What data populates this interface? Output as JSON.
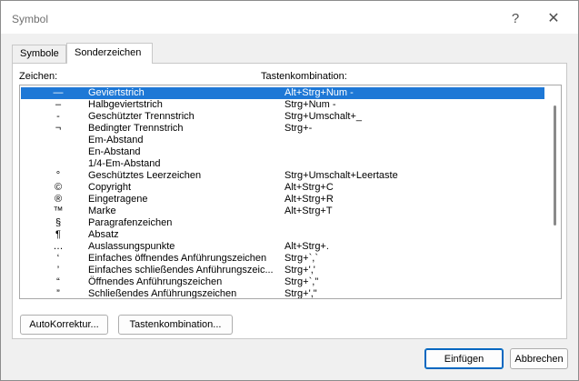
{
  "window": {
    "title": "Symbol",
    "help_glyph": "?",
    "close_glyph": "✕"
  },
  "tabs": [
    {
      "label": "Symbole"
    },
    {
      "label": "Sonderzeichen",
      "active": true
    }
  ],
  "columns": {
    "char_label": "Zeichen:",
    "shortcut_label": "Tastenkombination:"
  },
  "rows": [
    {
      "symbol": "—",
      "name": "Geviertstrich",
      "keys": "Alt+Strg+Num -",
      "selected": true
    },
    {
      "symbol": "–",
      "name": "Halbgeviertstrich",
      "keys": "Strg+Num -"
    },
    {
      "symbol": "-",
      "name": "Geschützter Trennstrich",
      "keys": "Strg+Umschalt+_"
    },
    {
      "symbol": "¬",
      "name": "Bedingter Trennstrich",
      "keys": "Strg+-"
    },
    {
      "symbol": "",
      "name": "Em-Abstand",
      "keys": ""
    },
    {
      "symbol": "",
      "name": "En-Abstand",
      "keys": ""
    },
    {
      "symbol": "",
      "name": "1/4-Em-Abstand",
      "keys": ""
    },
    {
      "symbol": "°",
      "name": "Geschütztes Leerzeichen",
      "keys": "Strg+Umschalt+Leertaste"
    },
    {
      "symbol": "©",
      "name": "Copyright",
      "keys": "Alt+Strg+C"
    },
    {
      "symbol": "®",
      "name": "Eingetragene",
      "keys": "Alt+Strg+R"
    },
    {
      "symbol": "™",
      "name": "Marke",
      "keys": "Alt+Strg+T"
    },
    {
      "symbol": "§",
      "name": "Paragrafenzeichen",
      "keys": ""
    },
    {
      "symbol": "¶",
      "name": "Absatz",
      "keys": ""
    },
    {
      "symbol": "…",
      "name": "Auslassungspunkte",
      "keys": "Alt+Strg+."
    },
    {
      "symbol": "‘",
      "name": "Einfaches öffnendes Anführungszeichen",
      "keys": "Strg+`,`"
    },
    {
      "symbol": "’",
      "name": "Einfaches schließendes Anführungszeic...",
      "keys": "Strg+','"
    },
    {
      "symbol": "“",
      "name": "Öffnendes Anführungszeichen",
      "keys": "Strg+`,\""
    },
    {
      "symbol": "”",
      "name": "Schließendes Anführungszeichen",
      "keys": "Strg+',\""
    }
  ],
  "buttons": {
    "autokorrektur": "AutoKorrektur...",
    "tastenkombination": "Tastenkombination...",
    "einfuegen": "Einfügen",
    "abbrechen": "Abbrechen"
  },
  "colors": {
    "selection": "#1e78d6",
    "default_button_border": "#0067c0"
  }
}
